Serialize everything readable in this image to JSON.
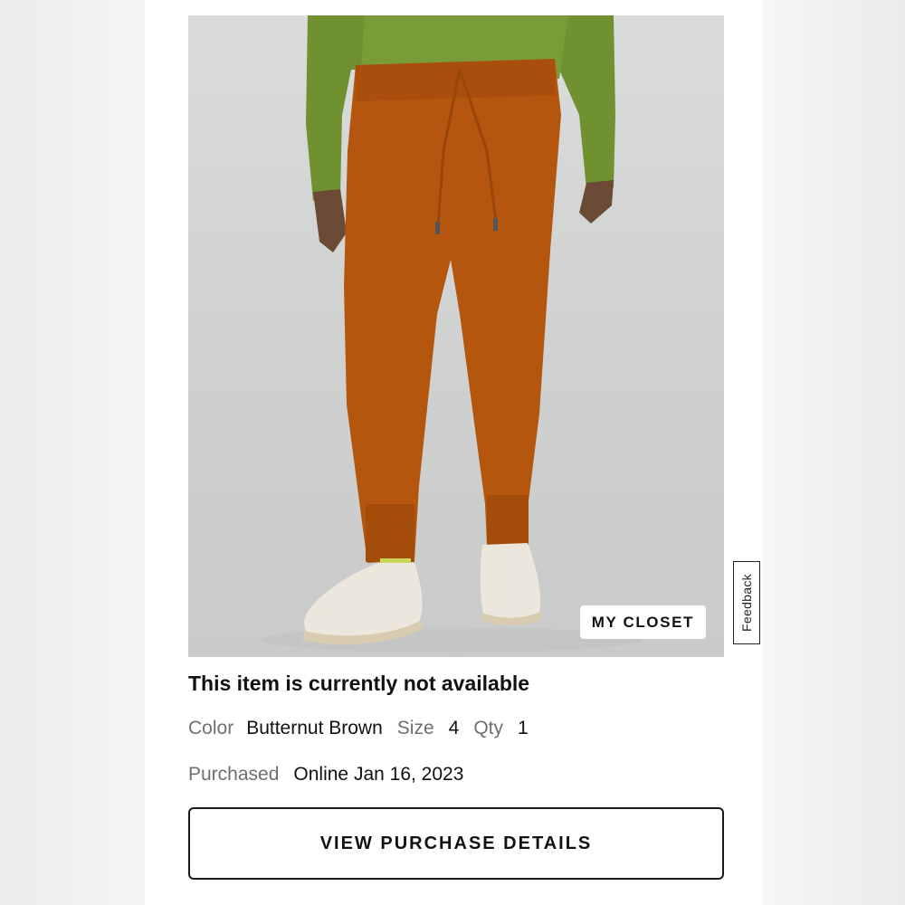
{
  "product_card": {
    "image_badge_label": "MY CLOSET",
    "status_text": "This item is currently not available",
    "details": {
      "color_label": "Color",
      "color_value": "Butternut Brown",
      "size_label": "Size",
      "size_value": "4",
      "qty_label": "Qty",
      "qty_value": "1",
      "purchased_label": "Purchased",
      "purchased_value": "Online Jan 16, 2023"
    },
    "cta_label": "VIEW PURCHASE DETAILS"
  },
  "feedback_tab": {
    "label": "Feedback"
  },
  "colors": {
    "pants": "#b5560e",
    "sweater": "#6f9130",
    "background_photo": "#d3d5d5",
    "text_primary": "#111111",
    "text_secondary": "#6f6f6f"
  }
}
